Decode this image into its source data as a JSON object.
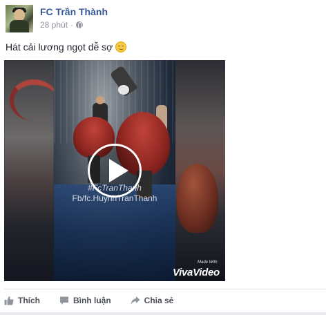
{
  "post": {
    "page_name": "FC Trần Thành",
    "time": "28 phút",
    "separator": "·",
    "message": "Hát cải lương ngọt dễ sợ",
    "message_emoji": "smiling-face-emoji",
    "video": {
      "watermark_line1": "#FcTranThanh",
      "watermark_line2": "Fb/fc.HuynhTranThanh",
      "made_with": "Made With",
      "brand": "VivaVideo",
      "play_icon": "play-icon"
    },
    "actions": [
      {
        "label": "Thích",
        "icon": "thumbs-up-icon"
      },
      {
        "label": "Bình luận",
        "icon": "comment-icon"
      },
      {
        "label": "Chia sẻ",
        "icon": "share-icon"
      }
    ]
  },
  "colors": {
    "page_name": "#365899",
    "meta_text": "#90949c",
    "action_text": "#4b4f56",
    "background": "#e9ebee"
  }
}
